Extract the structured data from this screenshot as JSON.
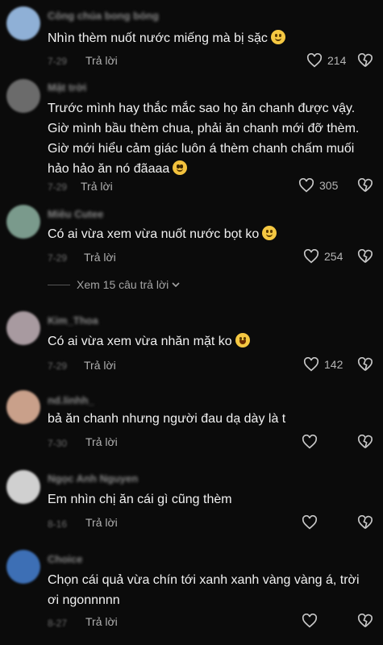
{
  "reply_label": "Trả lời",
  "view_more_label": "Xem 15 câu trả lời",
  "comments": [
    {
      "username": "Công chúa bong bóng",
      "text": "Nhìn thèm nuốt nước miếng mà bị sặc",
      "emoji": "slightly-smiling-face",
      "time": "7-29",
      "likes": "214",
      "avatar_color": "#8fb0d6"
    },
    {
      "username": "Mật trời",
      "text": "Trước mình hay thắc mắc sao họ ăn chanh được vậy. Giờ mình bầu thèm chua, phải ăn chanh mới đỡ thèm. Giờ mới hiểu cảm giác luôn á thèm chanh chấm muối hảo hảo ăn nó đãaaa",
      "emoji": "pleading-face",
      "time": "7-29",
      "likes": "305",
      "avatar_color": "#6b6b6b"
    },
    {
      "username": "Miêu Cutee",
      "text": "Có ai vừa xem vừa nuốt nước bọt ko",
      "emoji": "grinning-face-with-sweat",
      "time": "7-29",
      "likes": "254",
      "avatar_color": "#7a9a8c"
    },
    {
      "username": "Kim_Thoa",
      "text": "Có ai vừa xem vừa nhăn mặt ko",
      "emoji": "face-with-tears-of-joy",
      "time": "7-29",
      "likes": "142",
      "avatar_color": "#a89aa0"
    },
    {
      "username": "nd.linhh_",
      "text": "bả ăn chanh nhưng người đau dạ dày là t",
      "emoji": "",
      "time": "7-30",
      "likes": "",
      "avatar_color": "#c9a08a"
    },
    {
      "username": "Ngọc Anh Nguyen",
      "text": "Em nhìn chị ăn cái gì cũng thèm",
      "emoji": "",
      "time": "8-16",
      "likes": "",
      "avatar_color": "#d0d0d0"
    },
    {
      "username": "Choice",
      "text": "Chọn cái quả vừa chín tới xanh xanh vàng vàng á, trời ơi ngonnnnn",
      "emoji": "",
      "time": "8-27",
      "likes": "",
      "avatar_color": "#3d6fb5"
    }
  ]
}
